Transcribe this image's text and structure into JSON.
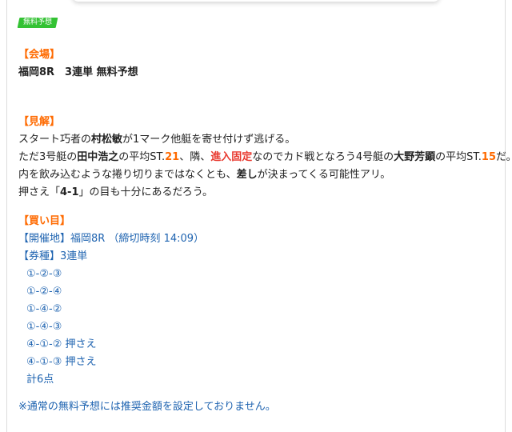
{
  "badge": "無料予想",
  "venue": {
    "heading": "【会場】",
    "text": "福岡8R　3連単 無料予想"
  },
  "opinion": {
    "heading": "【見解】",
    "line1_a": "スタート巧者の",
    "line1_b": "村松敏",
    "line1_c": "が1マーク他艇を寄せ付けず逃げる。",
    "line2_a": "ただ3号艇の",
    "line2_b": "田中浩之",
    "line2_c": "の平均ST.",
    "line2_d": "21",
    "line2_e": "、隣、",
    "line2_f": "進入固定",
    "line2_g": "なのでカド戦となろう4号艇の",
    "line2_h": "大野芳顕",
    "line2_i": "の平均ST.",
    "line2_j": "15",
    "line2_k": "だ。",
    "line3_a": "内を飲み込むような捲り切りまではなくとも、",
    "line3_b": "差し",
    "line3_c": "が決まってくる可能性アリ。",
    "line4_a": "押さえ「",
    "line4_b": "4-1",
    "line4_c": "」の目も十分にあるだろう。"
  },
  "bets": {
    "heading": "【買い目】",
    "venue_line": "【開催地】福岡8R （締切時刻 14:09）",
    "type_line": "【券種】3連単",
    "combos": [
      "①-②-③",
      "①-②-④",
      "①-④-②",
      "①-④-③",
      "④-①-② 押さえ",
      "④-①-③ 押さえ"
    ],
    "total": "計6点"
  },
  "note": "※通常の無料予想には推奨金額を設定しておりません。",
  "colors": {
    "accent_orange": "#ff6a00",
    "link_blue": "#1e63b0",
    "highlight_red": "#e8382e",
    "badge_green": "#33c233"
  }
}
